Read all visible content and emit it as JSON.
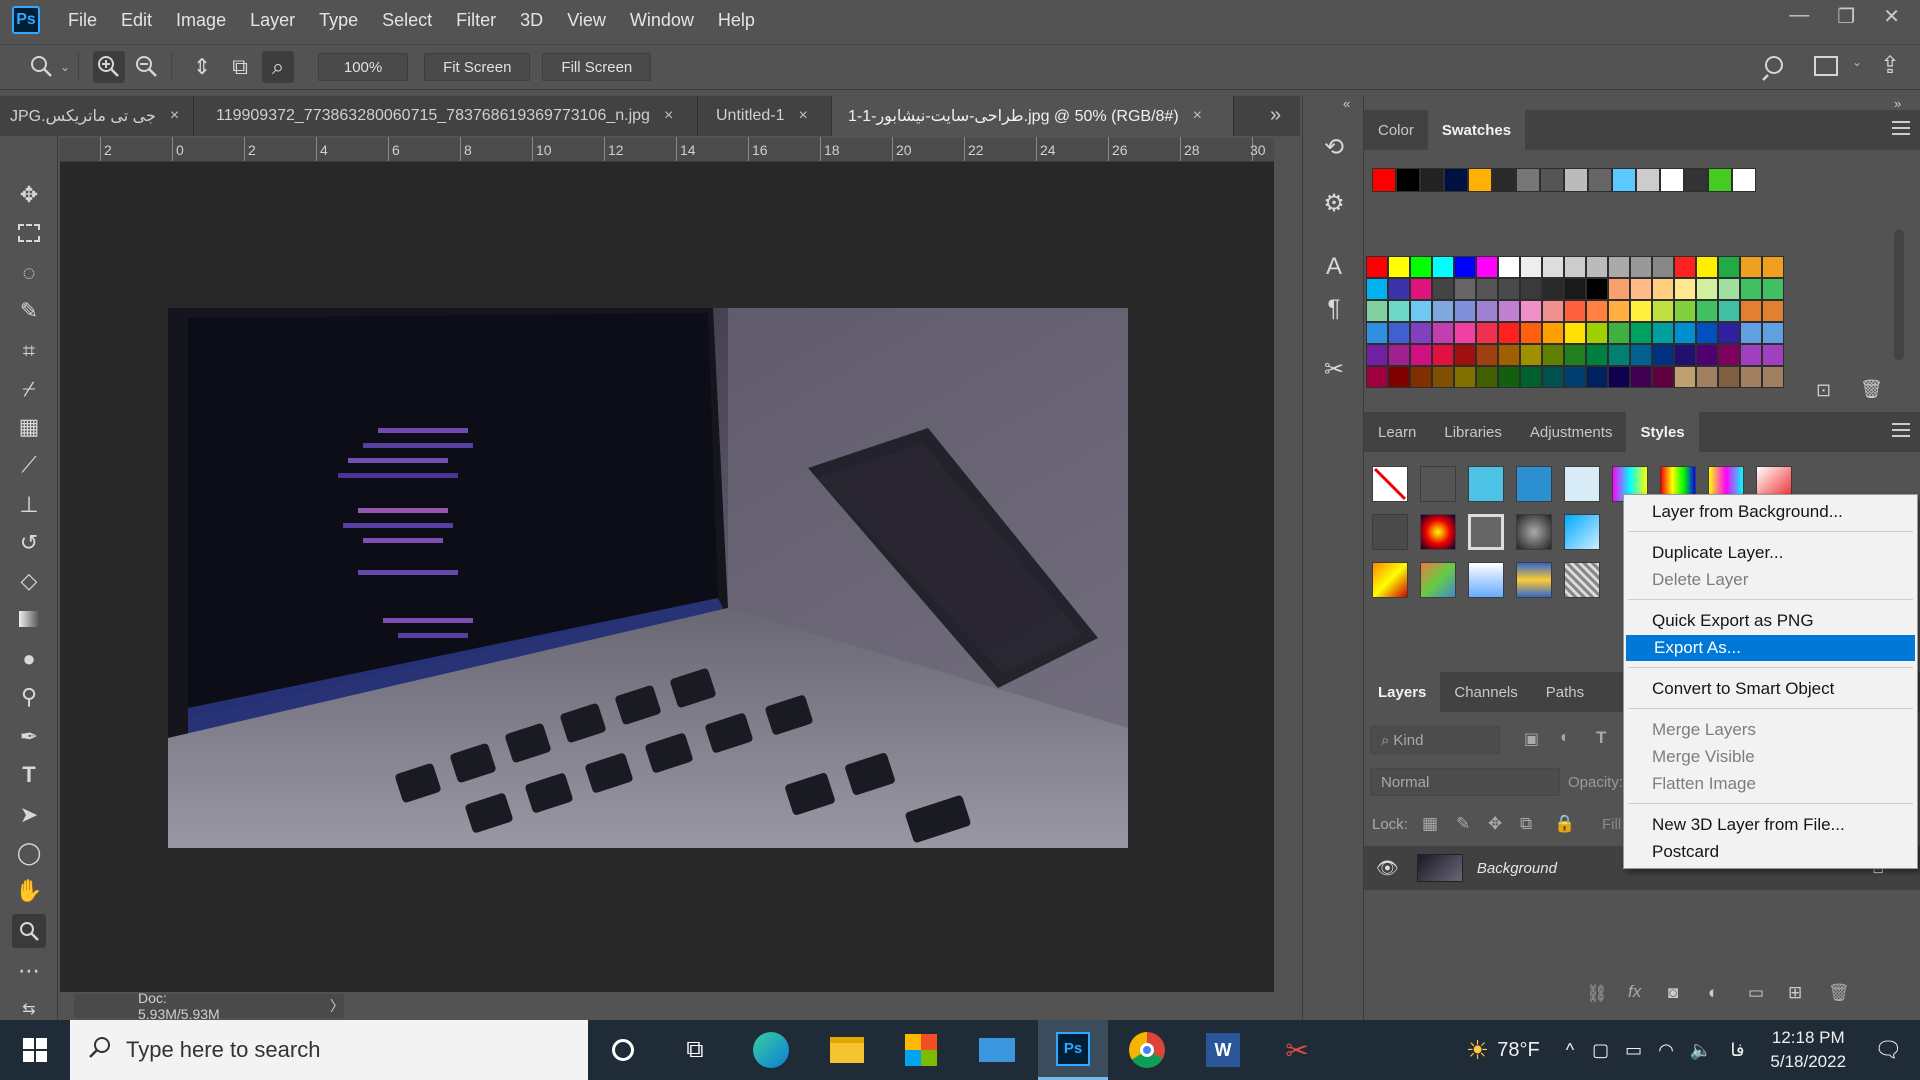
{
  "app": {
    "logo": "Ps",
    "menu": [
      "File",
      "Edit",
      "Image",
      "Layer",
      "Type",
      "Select",
      "Filter",
      "3D",
      "View",
      "Window",
      "Help"
    ]
  },
  "options_bar": {
    "zoom_value": "100%",
    "fit_screen_label": "Fit Screen",
    "fill_screen_label": "Fill Screen"
  },
  "tabs": [
    {
      "label": "جی تی ماتریکس.JPG",
      "close": "×"
    },
    {
      "label": "119909372_773863280060715_783768619369773106_n.jpg",
      "close": "×"
    },
    {
      "label": "Untitled-1",
      "close": "×"
    },
    {
      "label": "1-1-طراحی-سایت-نیشابور.jpg @ 50% (RGB/8#)",
      "close": "×"
    }
  ],
  "ruler": {
    "labels": [
      "2",
      "0",
      "2",
      "4",
      "6",
      "8",
      "10",
      "12",
      "14",
      "16",
      "18",
      "20",
      "22",
      "24",
      "26",
      "28",
      "30"
    ]
  },
  "status": {
    "doc_info": "Doc: 5.93M/5.93M",
    "arrow": "〉"
  },
  "color_panel": {
    "tabs": [
      "Color",
      "Swatches"
    ],
    "active": "Swatches"
  },
  "styles_panel": {
    "tabs": [
      "Learn",
      "Libraries",
      "Adjustments",
      "Styles"
    ],
    "active": "Styles"
  },
  "layers_panel": {
    "tabs": [
      "Layers",
      "Channels",
      "Paths"
    ],
    "active": "Layers",
    "filter_placeholder": "Kind",
    "blend_mode": "Normal",
    "opacity_label": "Opacity:",
    "lock_label": "Lock:",
    "fill_label": "Fill:",
    "layer_name": "Background"
  },
  "context_menu": {
    "items": [
      {
        "label": "Layer from Background...",
        "state": "enabled"
      },
      {
        "label": "Duplicate Layer...",
        "state": "enabled"
      },
      {
        "label": "Delete Layer",
        "state": "disabled"
      },
      {
        "label": "Quick Export as PNG",
        "state": "enabled"
      },
      {
        "label": "Export As...",
        "state": "highlighted"
      },
      {
        "label": "Convert to Smart Object",
        "state": "enabled"
      },
      {
        "label": "Merge Layers",
        "state": "disabled"
      },
      {
        "label": "Merge Visible",
        "state": "disabled"
      },
      {
        "label": "Flatten Image",
        "state": "disabled"
      },
      {
        "label": "New 3D Layer from File...",
        "state": "enabled"
      },
      {
        "label": "Postcard",
        "state": "enabled"
      }
    ]
  },
  "taskbar": {
    "search_placeholder": "Type here to search",
    "weather": "78°F",
    "lang": "فا",
    "time": "12:18 PM",
    "date": "5/18/2022"
  },
  "colors": {
    "accent": "#0078d7",
    "ps_blue": "#31a8ff"
  }
}
